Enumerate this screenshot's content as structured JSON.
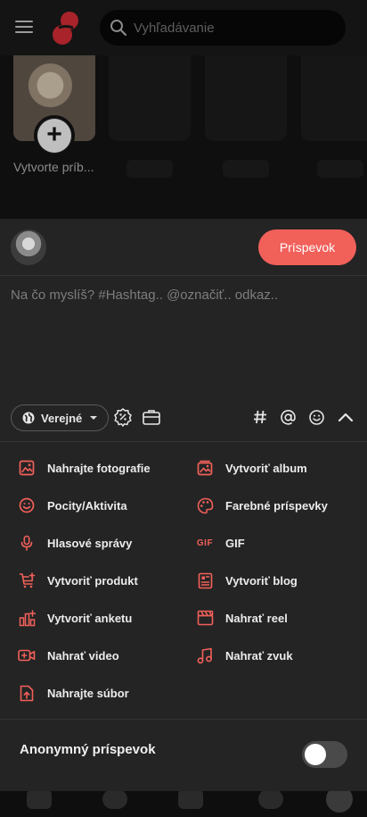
{
  "topbar": {
    "search_placeholder": "Vyhľadávanie",
    "icons": [
      "menu-icon",
      "logo",
      "search-icon"
    ]
  },
  "stories": {
    "create_label": "Vytvorte príb..."
  },
  "composer": {
    "publish_label": "Príspevok",
    "placeholder": "Na čo myslíš? #Hashtag.. @označiť.. odkaz..",
    "privacy_label": "Verejné",
    "tool_icons": [
      "globe-icon",
      "discount-icon",
      "briefcase-icon",
      "hashtag-icon",
      "mention-icon",
      "emoji-icon",
      "chevron-up-icon"
    ]
  },
  "actions": {
    "left": [
      {
        "label": "Nahrajte fotografie",
        "icon": "image-icon"
      },
      {
        "label": "Pocity/Aktivita",
        "icon": "smile-icon"
      },
      {
        "label": "Hlasové správy",
        "icon": "microphone-icon"
      },
      {
        "label": "Vytvoriť produkt",
        "icon": "cart-plus-icon"
      },
      {
        "label": "Vytvoriť anketu",
        "icon": "poll-icon"
      },
      {
        "label": "Nahrať video",
        "icon": "video-icon"
      },
      {
        "label": "Nahrajte súbor",
        "icon": "file-upload-icon"
      }
    ],
    "right": [
      {
        "label": "Vytvoriť album",
        "icon": "album-icon"
      },
      {
        "label": "Farebné príspevky",
        "icon": "palette-icon"
      },
      {
        "label": "GIF",
        "icon": "gif-icon",
        "glyph": "GIF"
      },
      {
        "label": "Vytvoriť blog",
        "icon": "blog-icon"
      },
      {
        "label": "Nahrať reel",
        "icon": "clapperboard-icon"
      },
      {
        "label": "Nahrať zvuk",
        "icon": "music-icon"
      }
    ]
  },
  "anonymous": {
    "label": "Anonymný príspevok",
    "enabled": false
  },
  "colors": {
    "accent": "#f2605a",
    "sheet_bg": "#242424",
    "page_bg": "#0b0b0b"
  }
}
